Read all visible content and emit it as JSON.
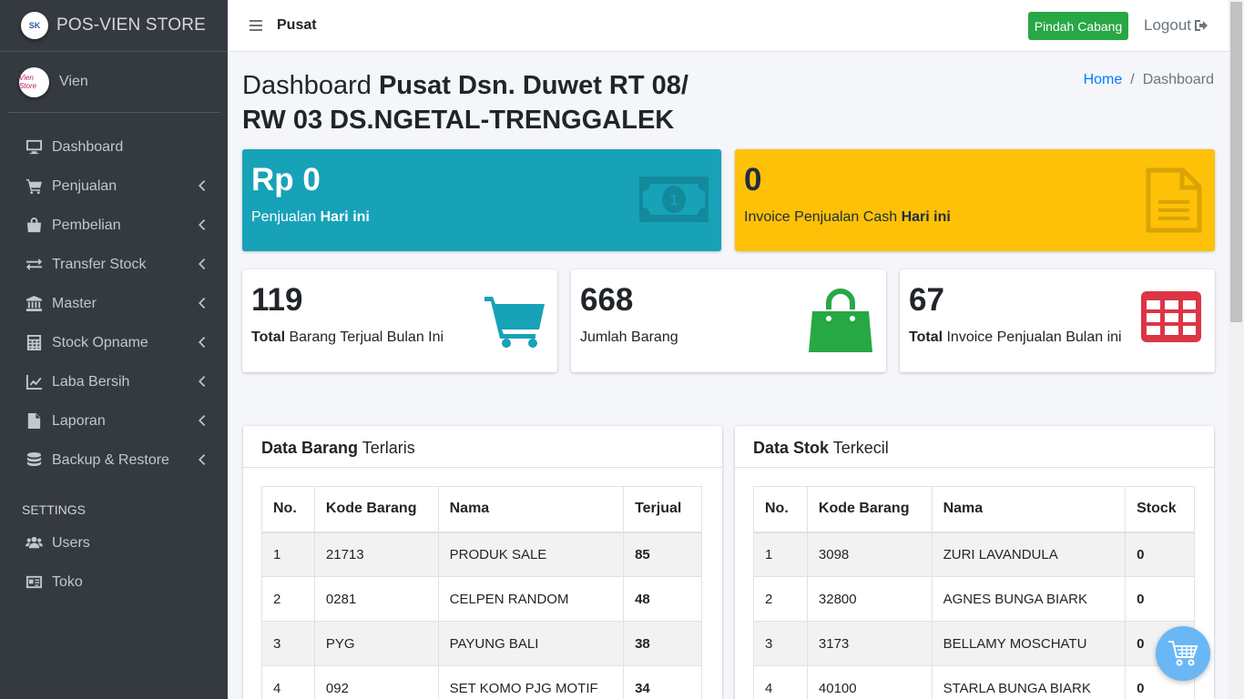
{
  "brand": {
    "name": "POS-VIEN STORE",
    "logo_text": "SK"
  },
  "user": {
    "name": "Vien",
    "avatar_text": "Vien Store"
  },
  "sidebar": {
    "items": [
      {
        "label": "Dashboard",
        "icon": "desktop-icon"
      },
      {
        "label": "Penjualan",
        "icon": "cart-icon"
      },
      {
        "label": "Pembelian",
        "icon": "shopping-bag-icon"
      },
      {
        "label": "Transfer Stock",
        "icon": "exchange-icon"
      },
      {
        "label": "Master",
        "icon": "bank-icon"
      },
      {
        "label": "Stock Opname",
        "icon": "calculator-icon"
      },
      {
        "label": "Laba Bersih",
        "icon": "line-chart-icon"
      },
      {
        "label": "Laporan",
        "icon": "file-icon"
      },
      {
        "label": "Backup & Restore",
        "icon": "database-icon"
      }
    ],
    "settings_header": "SETTINGS",
    "settings_items": [
      {
        "label": "Users",
        "icon": "users-icon"
      },
      {
        "label": "Toko",
        "icon": "id-card-icon"
      }
    ]
  },
  "navbar": {
    "branch": "Pusat",
    "switch_button": "Pindah Cabang",
    "logout": "Logout"
  },
  "page": {
    "title_prefix": "Dashboard",
    "title_bold": "Pusat Dsn. Duwet RT 08/ RW 03 DS.NGETAL-TRENGGALEK",
    "breadcrumb_home": "Home",
    "breadcrumb_sep": "/",
    "breadcrumb_current": "Dashboard"
  },
  "stats": {
    "sales_today": {
      "value": "Rp 0",
      "label": "Penjualan ",
      "label_bold": "Hari ini"
    },
    "cash_invoice_today": {
      "value": "0",
      "label": "Invoice Penjualan Cash ",
      "label_bold": "Hari ini"
    },
    "items_sold_month": {
      "value": "119",
      "label_bold": "Total",
      "label": " Barang Terjual Bulan Ini"
    },
    "item_count": {
      "value": "668",
      "label": "Jumlah Barang"
    },
    "invoices_month": {
      "value": "67",
      "label_bold": "Total",
      "label": " Invoice Penjualan Bulan ini"
    }
  },
  "best_sellers": {
    "title_bold": "Data Barang",
    "title": " Terlaris",
    "headers": [
      "No.",
      "Kode Barang",
      "Nama",
      "Terjual"
    ],
    "rows": [
      [
        "1",
        "21713",
        "PRODUK SALE",
        "85"
      ],
      [
        "2",
        "0281",
        "CELPEN RANDOM",
        "48"
      ],
      [
        "3",
        "PYG",
        "PAYUNG BALI",
        "38"
      ],
      [
        "4",
        "092",
        "SET KOMO PJG MOTIF",
        "34"
      ]
    ]
  },
  "lowest_stock": {
    "title_bold": "Data Stok",
    "title": " Terkecil",
    "headers": [
      "No.",
      "Kode Barang",
      "Nama",
      "Stock"
    ],
    "rows": [
      [
        "1",
        "3098",
        "ZURI LAVANDULA",
        "0"
      ],
      [
        "2",
        "32800",
        "AGNES BUNGA BIARK",
        "0"
      ],
      [
        "3",
        "3173",
        "BELLAMY MOSCHATU",
        "0"
      ],
      [
        "4",
        "40100",
        "STARLA BUNGA BIARK",
        "0"
      ]
    ]
  },
  "colors": {
    "teal": "#17a2b8",
    "yellow": "#ffc107",
    "green": "#28a745",
    "red": "#dc3545",
    "sidebar": "#343a40"
  }
}
